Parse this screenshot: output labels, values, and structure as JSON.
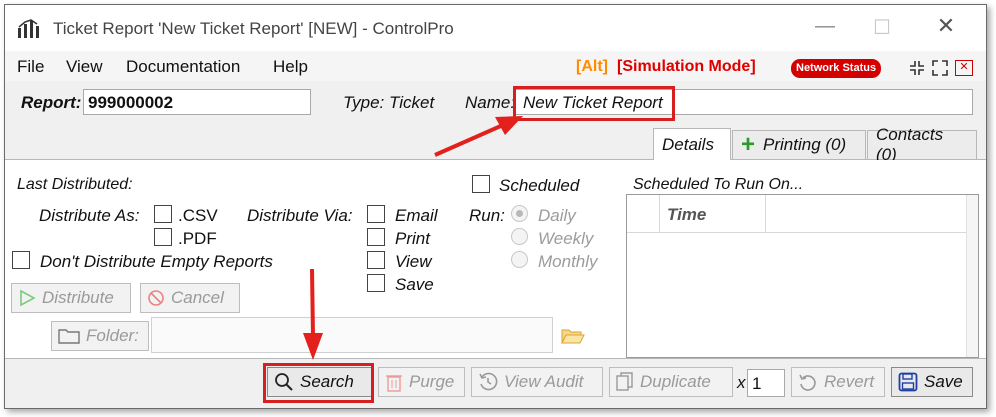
{
  "window": {
    "title": "Ticket Report 'New Ticket Report' [NEW] - ControlPro",
    "minimize": "—",
    "maximize": "☐",
    "close": "✕"
  },
  "menu": {
    "items": [
      "File",
      "View",
      "Documentation",
      "Help"
    ],
    "alt_tag": "[Alt]",
    "simulation_mode": "[Simulation Mode]",
    "network_status": "Network Status",
    "alt_color": "#ff8c00",
    "simulation_color": "#e00000"
  },
  "header": {
    "report_label": "Report:",
    "report_value": "999000002",
    "type_label": "Type: Ticket",
    "name_label": "Name:",
    "name_value": "New Ticket Report"
  },
  "tabs": [
    {
      "label": "Details",
      "active": true
    },
    {
      "label": "Printing (0)",
      "icon": "plus-icon"
    },
    {
      "label": "Contacts (0)"
    }
  ],
  "details": {
    "last_distributed_label": "Last Distributed:",
    "distribute_as_label": "Distribute As:",
    "formats": [
      ".CSV",
      ".PDF"
    ],
    "distribute_via_label": "Distribute Via:",
    "via_options": [
      "Email",
      "Print",
      "View",
      "Save"
    ],
    "dont_distribute_empty": "Don't Distribute Empty Reports",
    "distribute_button": "Distribute",
    "cancel_button": "Cancel",
    "folder_label": "Folder:",
    "folder_value": ""
  },
  "schedule": {
    "scheduled_label": "Scheduled",
    "run_label": "Run:",
    "run_options": [
      {
        "label": "Daily",
        "selected": true
      },
      {
        "label": "Weekly",
        "selected": false
      },
      {
        "label": "Monthly",
        "selected": false
      }
    ],
    "scheduled_to_run_label": "Scheduled To Run On...",
    "table_column": "Time"
  },
  "toolbar": {
    "search": "Search",
    "purge": "Purge",
    "view_audit": "View Audit",
    "duplicate": "Duplicate",
    "multiplier_label": "x",
    "multiplier_value": "1",
    "revert": "Revert",
    "save": "Save"
  },
  "annotations": {
    "highlight_color": "#d81f1f",
    "arrow_color": "#e3201b"
  }
}
